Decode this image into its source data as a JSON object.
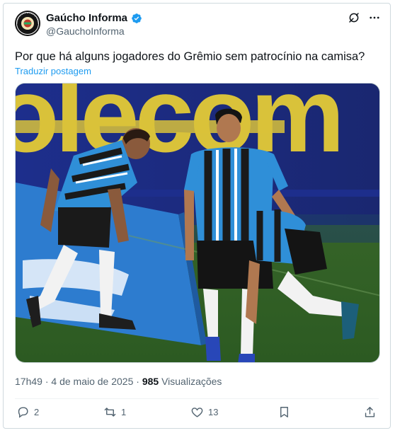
{
  "author": {
    "name": "Gaúcho Informa",
    "handle": "@GauchoInforma",
    "avatar_icon": "gaucho-informa-logo",
    "verified": true,
    "verified_color": "#1d9bf0"
  },
  "header_actions": [
    "grok-icon",
    "more-icon"
  ],
  "tweet": {
    "text": "Por que há alguns jogadores do Grêmio sem patrocínio na camisa?",
    "translate_label": "Traduzir postagem"
  },
  "media": {
    "type": "photo",
    "board_text": "olecom"
  },
  "meta": {
    "time": "17h49",
    "separator": "·",
    "date": "4 de maio de 2025",
    "views_count": "985",
    "views_label": "Visualizações"
  },
  "actions": {
    "replies": "2",
    "reposts": "1",
    "likes": "13"
  },
  "colors": {
    "accent": "#1d9bf0",
    "text_secondary": "#536471",
    "border": "#cfd9de"
  }
}
